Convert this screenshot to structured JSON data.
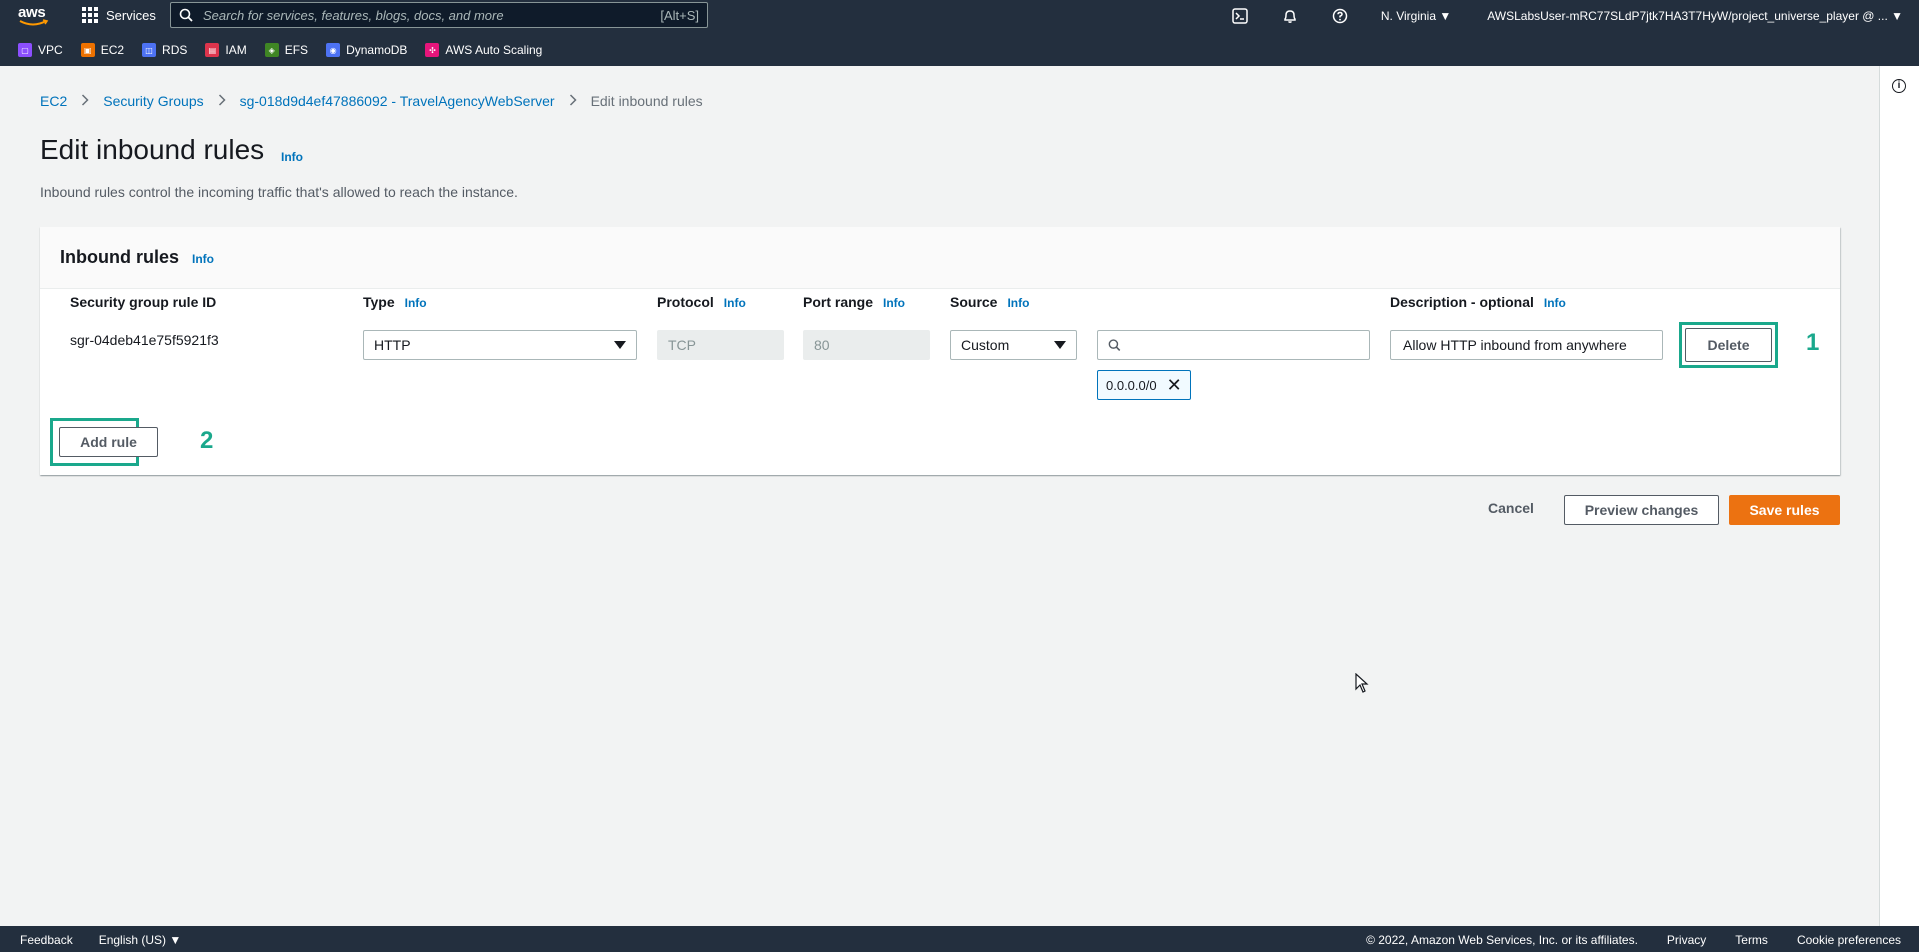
{
  "nav": {
    "logo_text": "aws",
    "services_label": "Services",
    "search_placeholder": "Search for services, features, blogs, docs, and more",
    "search_shortcut": "[Alt+S]",
    "region": "N. Virginia ▼",
    "account": "AWSLabsUser-mRC77SLdP7jtk7HA3T7HyW/project_universe_player @ ... ▼",
    "icons": [
      "cloudshell-icon",
      "bell-icon",
      "help-icon"
    ],
    "favorites": [
      {
        "label": "VPC",
        "icon": "vpc-icon",
        "color": "#8c4fff"
      },
      {
        "label": "EC2",
        "icon": "ec2-icon",
        "color": "#ed7100"
      },
      {
        "label": "RDS",
        "icon": "rds-icon",
        "color": "#4d72f3"
      },
      {
        "label": "IAM",
        "icon": "iam-icon",
        "color": "#dd344c"
      },
      {
        "label": "EFS",
        "icon": "efs-icon",
        "color": "#3f8624"
      },
      {
        "label": "DynamoDB",
        "icon": "dynamodb-icon",
        "color": "#4d72f3"
      },
      {
        "label": "AWS Auto Scaling",
        "icon": "auto-scaling-icon",
        "color": "#e7157b"
      }
    ]
  },
  "breadcrumb": {
    "items": [
      "EC2",
      "Security Groups",
      "sg-018d9d4ef47886092 - TravelAgencyWebServer"
    ],
    "current": "Edit inbound rules",
    "separator": ">"
  },
  "page": {
    "title": "Edit inbound rules",
    "info": "Info",
    "description": "Inbound rules control the incoming traffic that's allowed to reach the instance."
  },
  "panel": {
    "title": "Inbound rules",
    "info": "Info",
    "columns": {
      "rule_id": "Security group rule ID",
      "type": "Type",
      "protocol": "Protocol",
      "port_range": "Port range",
      "source": "Source",
      "description": "Description - optional",
      "info": "Info"
    },
    "rule": {
      "id": "sgr-04deb41e75f5921f3",
      "type": "HTTP",
      "protocol": "TCP",
      "port_range": "80",
      "source": "Custom",
      "source_search": "",
      "cidr_token": "0.0.0.0/0",
      "token_remove": "✕",
      "description": "Allow HTTP inbound from anywhere",
      "delete_label": "Delete"
    },
    "add_rule_label": "Add rule"
  },
  "annotations": {
    "one": "1",
    "two": "2",
    "highlight_color": "#1aa88c"
  },
  "actions": {
    "cancel": "Cancel",
    "preview": "Preview changes",
    "save": "Save rules"
  },
  "footer": {
    "feedback": "Feedback",
    "language": "English (US) ▼",
    "copyright": "© 2022, Amazon Web Services, Inc. or its affiliates.",
    "privacy": "Privacy",
    "terms": "Terms",
    "cookies": "Cookie preferences"
  },
  "colors": {
    "nav_bg": "#232f3e",
    "link": "#0073bb",
    "primary": "#ec7211",
    "page_bg": "#f2f3f3"
  }
}
